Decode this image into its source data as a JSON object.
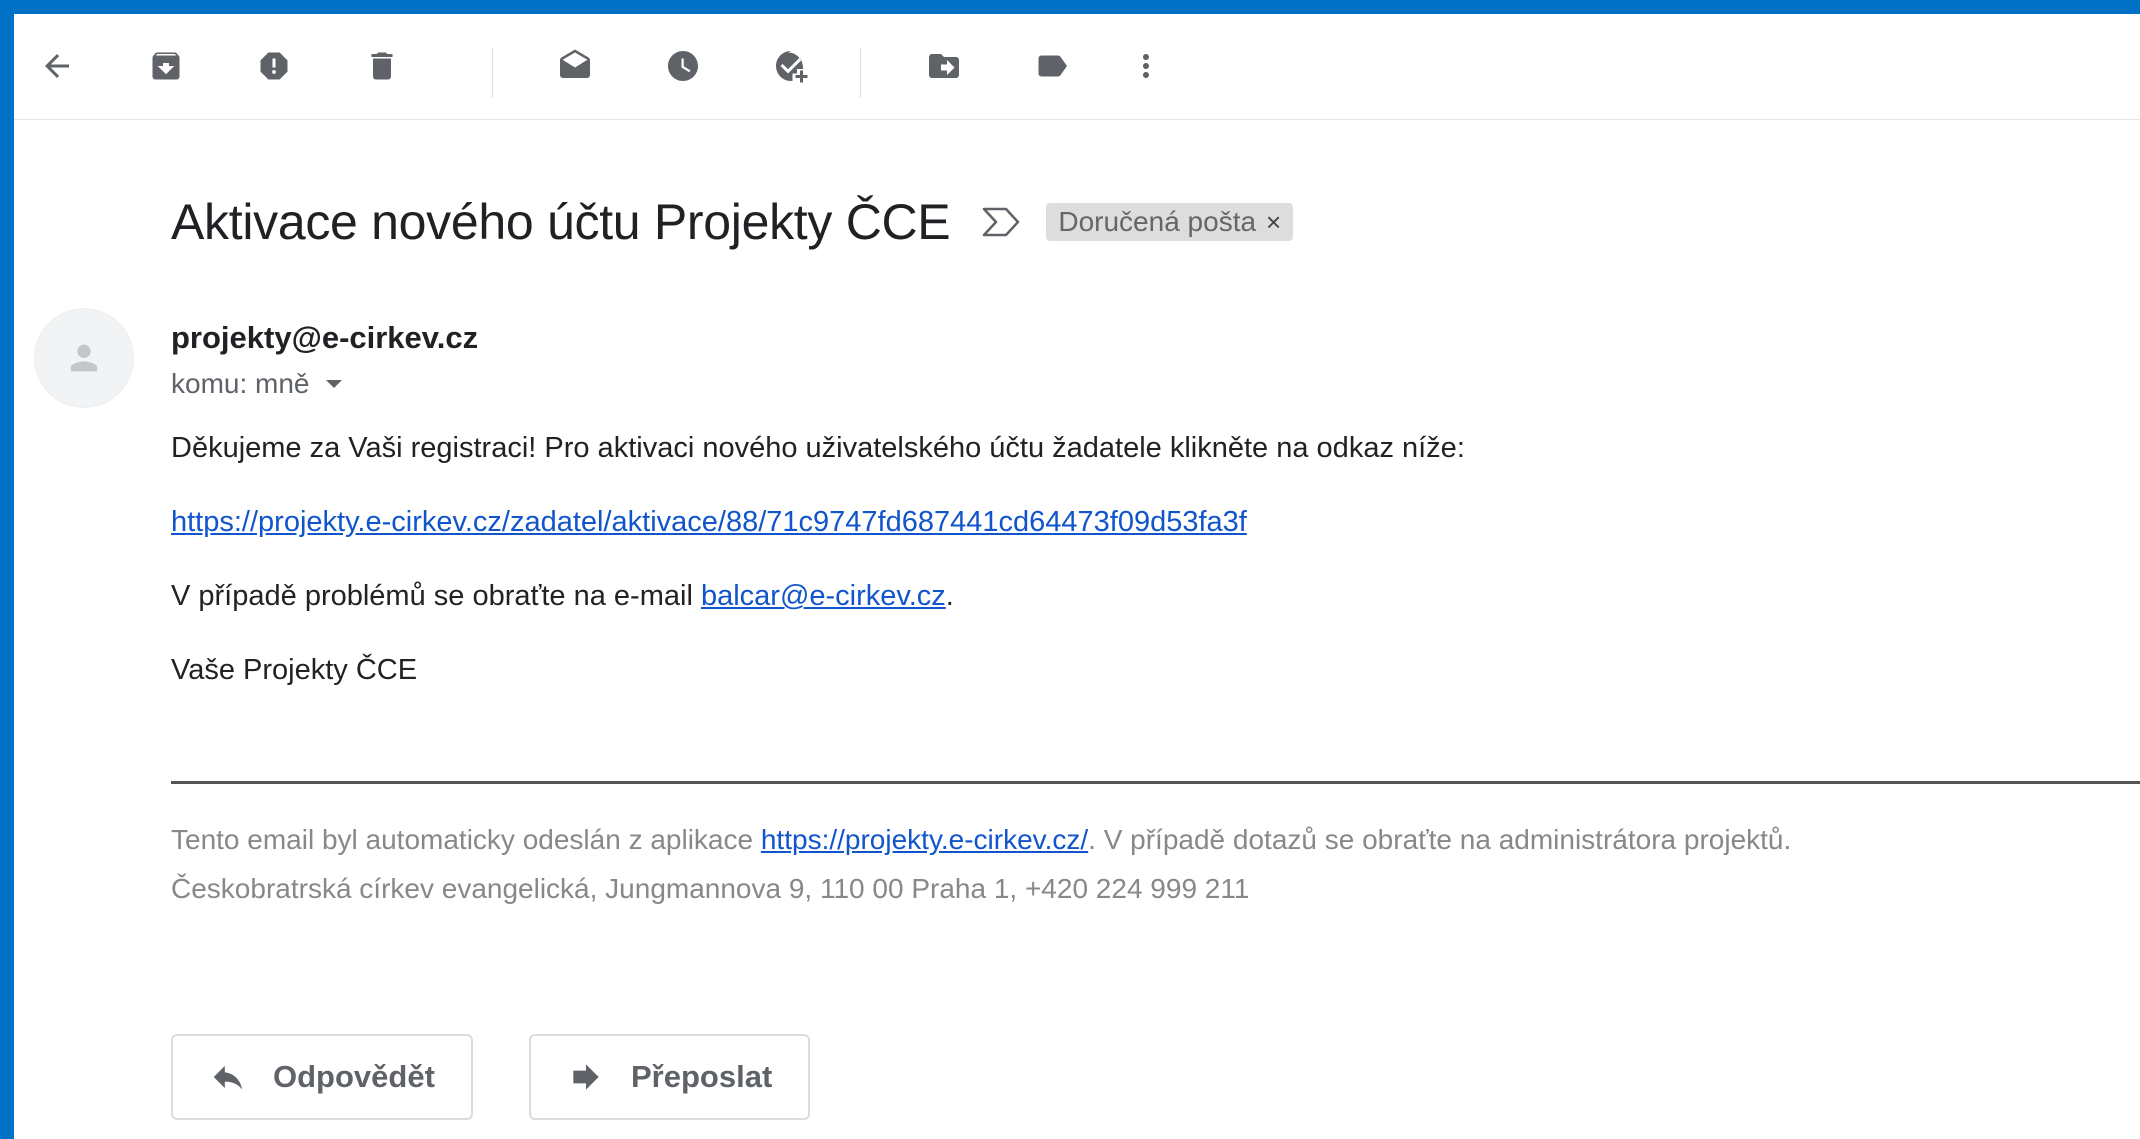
{
  "toolbar": {
    "icons": [
      "back-arrow-icon",
      "archive-icon",
      "report-spam-icon",
      "delete-icon",
      "mark-unread-icon",
      "snooze-icon",
      "add-to-tasks-icon",
      "move-to-icon",
      "labels-icon",
      "more-vert-icon"
    ]
  },
  "email": {
    "subject": "Aktivace nového účtu Projekty ČCE",
    "label_chip": "Doručená pošta",
    "label_chip_close": "×",
    "sender": "projekty@e-cirkev.cz",
    "recipient": "komu: mně",
    "body": {
      "line1": "Děkujeme za Vaši registraci! Pro aktivaci nového uživatelského účtu žadatele klikněte na odkaz níže:",
      "activation_link": "https://projekty.e-cirkev.cz/zadatel/aktivace/88/71c9747fd687441cd64473f09d53fa3f",
      "problem_prefix": "V případě problémů se obraťte na e-mail ",
      "problem_email": "balcar@e-cirkev.cz",
      "problem_suffix": ".",
      "signature": "Vaše Projekty ČCE"
    },
    "footer": {
      "prefix": "Tento email byl automaticky odeslán z aplikace ",
      "app_link": "https://projekty.e-cirkev.cz/",
      "suffix": ". V případě dotazů se obraťte na administrátora projektů.",
      "address": "Českobratrská církev evangelická, Jungmannova 9, 110 00 Praha 1, +420 224 999 211"
    }
  },
  "actions": {
    "reply": "Odpovědět",
    "forward": "Přeposlat"
  },
  "colors": {
    "frame": "#0072c6",
    "link": "#1155cc",
    "icon": "#5f6368"
  }
}
